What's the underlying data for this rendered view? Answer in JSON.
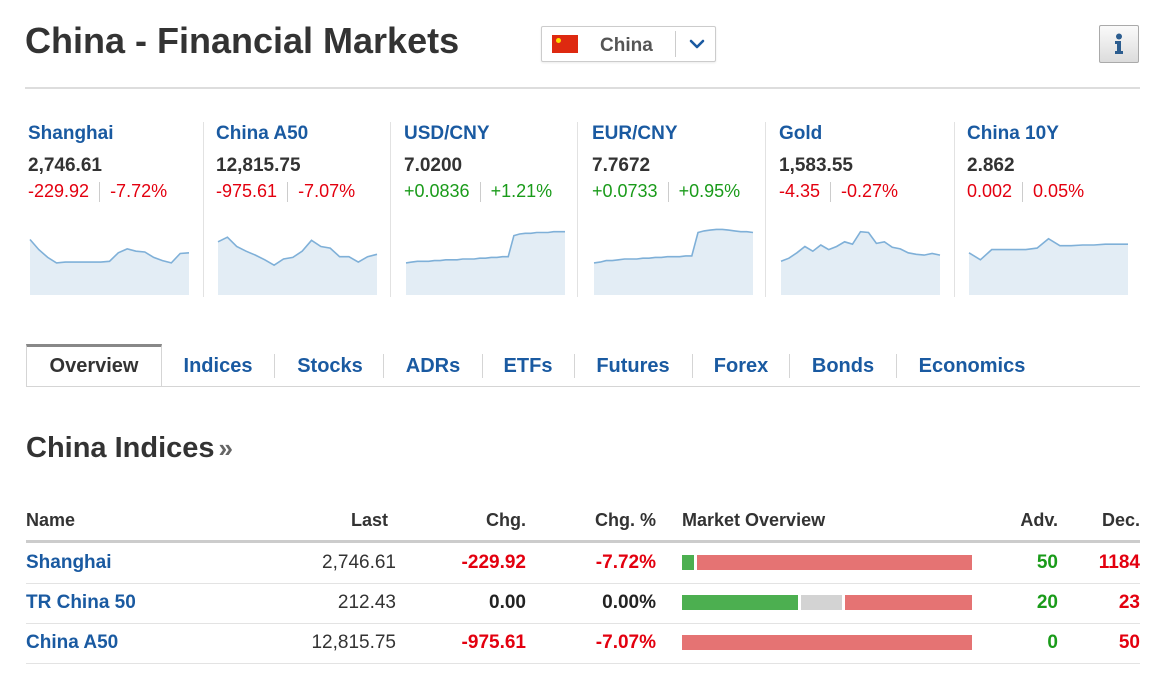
{
  "header": {
    "title": "China - Financial Markets",
    "country": "China",
    "info_icon": "info-icon"
  },
  "colors": {
    "link": "#1a5aa1",
    "up": "#1a9b1a",
    "down": "#e3000f",
    "bar_adv": "#4caf50",
    "bar_unch": "#d3d3d3",
    "bar_dec": "#e57373",
    "spark_line": "#7fb0d8",
    "spark_fill": "#e3edf5"
  },
  "tiles": [
    {
      "name": "Shanghai",
      "last": "2,746.61",
      "chg": "-229.92",
      "pct": "-7.72%",
      "dir": "down",
      "spark": [
        75,
        62,
        52,
        45,
        46,
        46,
        46,
        46,
        46,
        47,
        58,
        63,
        60,
        59,
        52,
        48,
        45,
        57,
        58
      ]
    },
    {
      "name": "China A50",
      "last": "12,815.75",
      "chg": "-975.61",
      "pct": "-7.07%",
      "dir": "down",
      "spark": [
        72,
        78,
        66,
        60,
        55,
        49,
        42,
        50,
        52,
        60,
        74,
        66,
        64,
        53,
        53,
        46,
        53,
        56
      ]
    },
    {
      "name": "USD/CNY",
      "last": "7.0200",
      "chg": "+0.0836",
      "pct": "+1.21%",
      "dir": "up",
      "spark": [
        45,
        46,
        47,
        47,
        47,
        48,
        48,
        49,
        49,
        49,
        50,
        50,
        50,
        51,
        51,
        52,
        52,
        53,
        53,
        80,
        82,
        83,
        83,
        84,
        84,
        84,
        85,
        85,
        85
      ]
    },
    {
      "name": "EUR/CNY",
      "last": "7.7672",
      "chg": "+0.0733",
      "pct": "+0.95%",
      "dir": "up",
      "spark": [
        45,
        46,
        48,
        48,
        49,
        50,
        50,
        50,
        51,
        51,
        52,
        52,
        53,
        53,
        53,
        54,
        54,
        84,
        86,
        87,
        88,
        88,
        87,
        86,
        85,
        85,
        84
      ]
    },
    {
      "name": "Gold",
      "last": "1,583.55",
      "chg": "-4.35",
      "pct": "-0.27%",
      "dir": "down",
      "spark": [
        47,
        51,
        58,
        66,
        60,
        68,
        62,
        66,
        72,
        69,
        85,
        84,
        70,
        72,
        65,
        63,
        58,
        56,
        55,
        57,
        55
      ]
    },
    {
      "name": "China 10Y",
      "last": "2.862",
      "chg": "0.002",
      "pct": "0.05%",
      "dir": "down",
      "spark": [
        58,
        49,
        62,
        62,
        62,
        62,
        64,
        76,
        67,
        67,
        68,
        68,
        69,
        69,
        69
      ]
    }
  ],
  "tabs": [
    "Overview",
    "Indices",
    "Stocks",
    "ADRs",
    "ETFs",
    "Futures",
    "Forex",
    "Bonds",
    "Economics"
  ],
  "section_title": "China Indices",
  "section_arrows": "»",
  "table": {
    "columns": [
      "Name",
      "Last",
      "Chg.",
      "Chg. %",
      "Market Overview",
      "Adv.",
      "Dec."
    ],
    "rows": [
      {
        "name": "Shanghai",
        "last": "2,746.61",
        "chg": "-229.92",
        "pct": "-7.72%",
        "dir": "down",
        "adv": "50",
        "dec": "1184",
        "adv_share": 0.04,
        "unch_share": 0.001
      },
      {
        "name": "TR China 50",
        "last": "212.43",
        "chg": "0.00",
        "pct": "0.00%",
        "dir": "flat",
        "adv": "20",
        "dec": "23",
        "adv_share": 0.4,
        "unch_share": 0.14
      },
      {
        "name": "China A50",
        "last": "12,815.75",
        "chg": "-975.61",
        "pct": "-7.07%",
        "dir": "down",
        "adv": "0",
        "dec": "50",
        "adv_share": 0.0,
        "unch_share": 0.0
      }
    ]
  }
}
